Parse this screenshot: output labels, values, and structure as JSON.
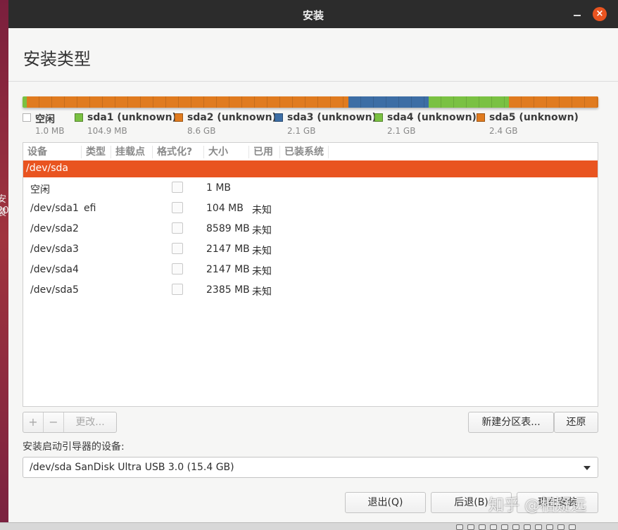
{
  "window": {
    "title": "安装",
    "close_glyph": "×"
  },
  "header": {
    "page_title": "安装类型"
  },
  "desktop": {
    "label_top": "安装",
    "label_bottom": "20"
  },
  "colors": {
    "accent": "#e95420",
    "orange": "#e07b1f",
    "blue": "#3d6ea5",
    "green": "#7ac142",
    "free": "#ffffff"
  },
  "partition_bar": [
    {
      "name": "空闲",
      "color": "#e07b1f",
      "size_mb": 1
    },
    {
      "name": "sda1",
      "color": "#7ac142",
      "size_mb": 104
    },
    {
      "name": "sda2",
      "color": "#e07b1f",
      "size_mb": 8589
    },
    {
      "name": "sda3",
      "color": "#3d6ea5",
      "size_mb": 2147
    },
    {
      "name": "sda4",
      "color": "#7ac142",
      "size_mb": 2147
    },
    {
      "name": "sda5",
      "color": "#e07b1f",
      "size_mb": 2385
    }
  ],
  "legend": [
    {
      "name": "空闲",
      "size": "1.0 MB",
      "color": "#ffffff"
    },
    {
      "name": "sda1 (unknown)",
      "size": "104.9 MB",
      "color": "#7ac142"
    },
    {
      "name": "sda2 (unknown)",
      "size": "8.6 GB",
      "color": "#e07b1f"
    },
    {
      "name": "sda3 (unknown)",
      "size": "2.1 GB",
      "color": "#3d6ea5"
    },
    {
      "name": "sda4 (unknown)",
      "size": "2.1 GB",
      "color": "#7ac142"
    },
    {
      "name": "sda5 (unknown)",
      "size": "2.4 GB",
      "color": "#e07b1f"
    }
  ],
  "table": {
    "columns": [
      "设备",
      "类型",
      "挂载点",
      "格式化?",
      "大小",
      "已用",
      "已装系统"
    ],
    "device_row": "/dev/sda",
    "rows": [
      {
        "device": "空闲",
        "type": "",
        "mount": "",
        "format": false,
        "size": "1 MB",
        "used": "",
        "system": ""
      },
      {
        "device": "/dev/sda1",
        "type": "efi",
        "mount": "",
        "format": false,
        "size": "104 MB",
        "used": "未知",
        "system": ""
      },
      {
        "device": "/dev/sda2",
        "type": "",
        "mount": "",
        "format": false,
        "size": "8589 MB",
        "used": "未知",
        "system": ""
      },
      {
        "device": "/dev/sda3",
        "type": "",
        "mount": "",
        "format": false,
        "size": "2147 MB",
        "used": "未知",
        "system": ""
      },
      {
        "device": "/dev/sda4",
        "type": "",
        "mount": "",
        "format": false,
        "size": "2147 MB",
        "used": "未知",
        "system": ""
      },
      {
        "device": "/dev/sda5",
        "type": "",
        "mount": "",
        "format": false,
        "size": "2385 MB",
        "used": "未知",
        "system": ""
      }
    ]
  },
  "controls": {
    "add": "+",
    "remove": "−",
    "change": "更改...",
    "new_table": "新建分区表...",
    "revert": "还原"
  },
  "bootloader": {
    "label": "安装启动引导器的设备:",
    "selected": "/dev/sda SanDisk Ultra USB 3.0 (15.4 GB)"
  },
  "footer": {
    "quit": "退出(Q)",
    "back": "后退(B)",
    "install": "现在安装"
  },
  "watermark": "知乎 @相疑远"
}
